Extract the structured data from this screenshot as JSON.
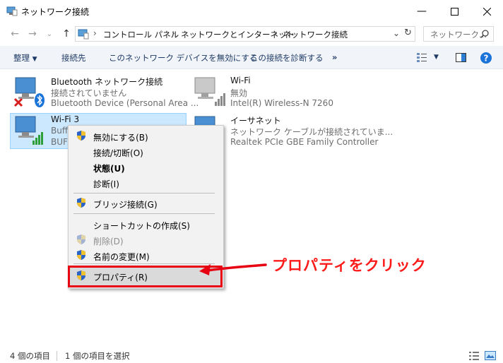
{
  "window": {
    "title": "ネットワーク接続",
    "controls": [
      "minimize-icon",
      "maximize-icon",
      "close-icon"
    ]
  },
  "address_bar": {
    "segments": [
      "コントロール パネル",
      "ネットワークとインターネット",
      "ネットワーク接続"
    ],
    "search_placeholder": "ネットワーク..."
  },
  "toolbar": {
    "organize": "整理",
    "connect_to": "接続先",
    "disable_device": "このネットワーク デバイスを無効にする",
    "diagnose": "この接続を診断する",
    "more": "»"
  },
  "items": [
    {
      "name": "Bluetooth ネットワーク接続",
      "status": "接続されていません",
      "device": "Bluetooth Device (Personal Area ..."
    },
    {
      "name": "Wi-Fi",
      "status": "無効",
      "device": "Intel(R) Wireless-N 7260"
    },
    {
      "name": "Wi-Fi 3",
      "status": "Buffa",
      "device": "BUFF"
    },
    {
      "name": "イーサネット",
      "status": "ネットワーク ケーブルが接続されていま...",
      "device": "Realtek PCIe GBE Family Controller"
    }
  ],
  "context_menu": {
    "disable": "無効にする(B)",
    "connect": "接続/切断(O)",
    "status": "状態(U)",
    "diagnose": "診断(I)",
    "bridge": "ブリッジ接続(G)",
    "shortcut": "ショートカットの作成(S)",
    "delete": "削除(D)",
    "rename": "名前の変更(M)",
    "properties": "プロパティ(R)"
  },
  "annotation": "プロパティをクリック",
  "status_bar": {
    "count": "4 個の項目",
    "selected": "1 個の項目を選択"
  },
  "colors": {
    "selection": "#cce8ff",
    "annotation_red": "#e60012",
    "toolbar_bg": "#f1f4f8",
    "help_blue": "#1a73d9"
  }
}
